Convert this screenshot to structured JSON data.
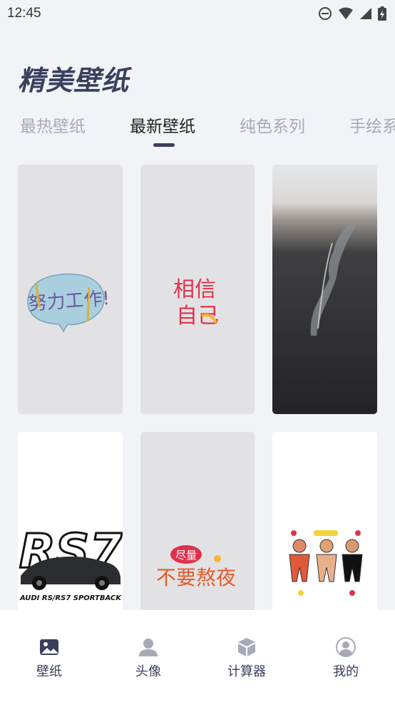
{
  "status_bar": {
    "time": "12:45"
  },
  "header": {
    "title": "精美壁纸"
  },
  "tabs": [
    {
      "label": "最热壁纸",
      "active": false
    },
    {
      "label": "最新壁纸",
      "active": true
    },
    {
      "label": "纯色系列",
      "active": false
    },
    {
      "label": "手绘系列",
      "active": false
    }
  ],
  "wallpapers": [
    {
      "text": "努力工作!"
    },
    {
      "text_line1": "相信",
      "text_line2": "自己"
    },
    {
      "subject": "river-landscape"
    },
    {
      "text_big": "RS7",
      "caption": "AUDI RS/RS7 SPORTBACK"
    },
    {
      "badge": "尽量",
      "text": "不要熬夜"
    },
    {
      "subject": "three-bears"
    }
  ],
  "bottom_nav": [
    {
      "label": "壁纸",
      "icon": "image-icon",
      "active": true
    },
    {
      "label": "头像",
      "icon": "person-icon",
      "active": false
    },
    {
      "label": "计算器",
      "icon": "cube-icon",
      "active": false
    },
    {
      "label": "我的",
      "icon": "profile-icon",
      "active": false
    }
  ],
  "colors": {
    "background": "#f1f3f7",
    "accent": "#3a3f5c",
    "tab_inactive": "#a7abb8",
    "card_grey": "#e1e1e3"
  }
}
